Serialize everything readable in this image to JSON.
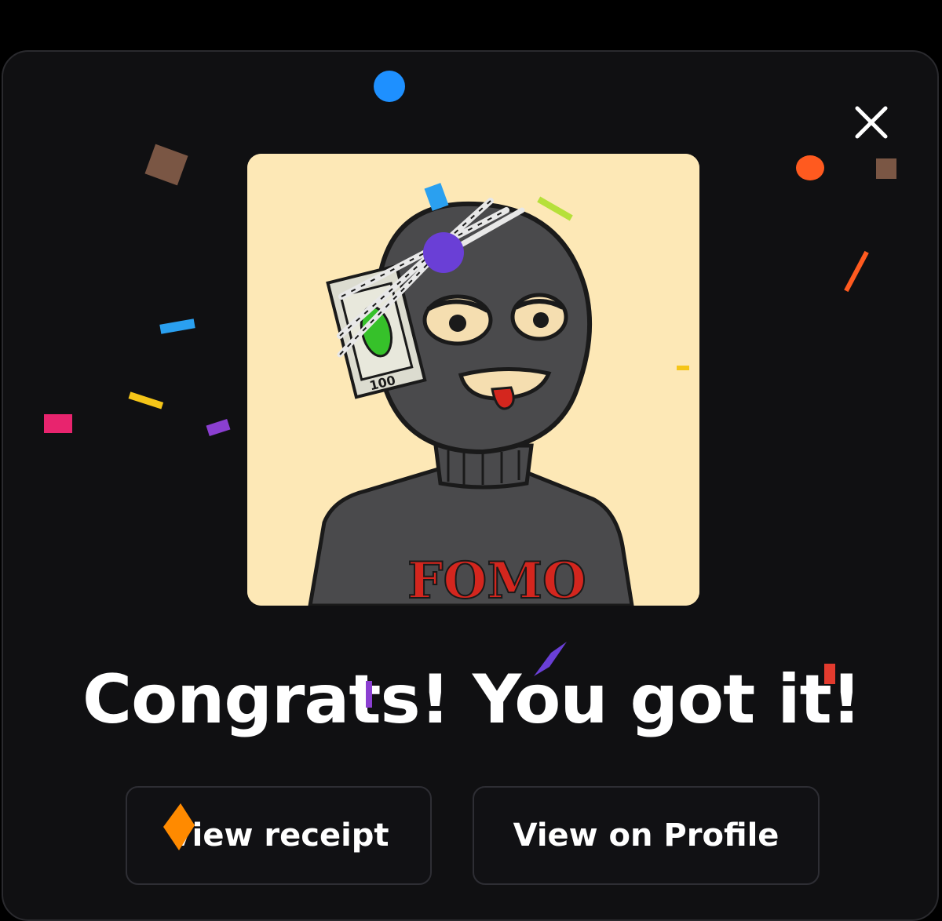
{
  "modal": {
    "headline": "Congrats! You got it!",
    "close_icon": "close-icon",
    "nft_image": {
      "description_icon": "nft-avatar-image",
      "sweater_text": "FOMO",
      "bill_text": "100"
    },
    "buttons": {
      "view_receipt": "View receipt",
      "view_on_profile": "View on Profile"
    }
  },
  "colors": {
    "background": "#000000",
    "modal_bg": "#101012",
    "nft_bg": "#fde8b6",
    "text": "#ffffff",
    "confetti": [
      "#1e90ff",
      "#ff5a1f",
      "#7a5644",
      "#e8246e",
      "#f5c518",
      "#8b3fd1",
      "#2aa0f0",
      "#b6e03a",
      "#ff8a00",
      "#6a3fd6"
    ]
  }
}
